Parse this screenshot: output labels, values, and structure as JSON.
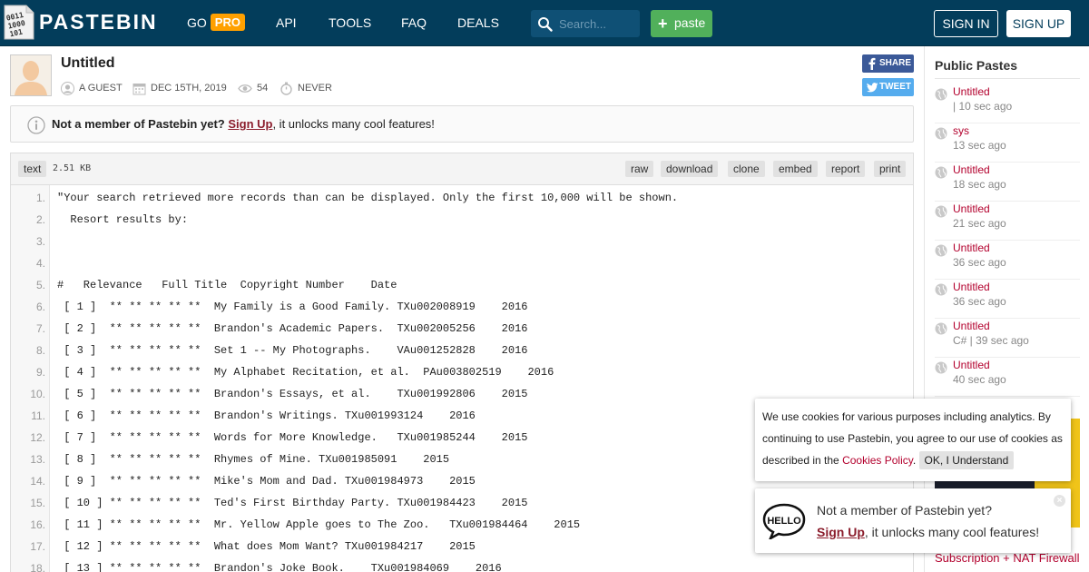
{
  "header": {
    "logo_text": "PASTEBIN",
    "nav": {
      "go": "GO",
      "pro": "PRO",
      "api": "API",
      "tools": "TOOLS",
      "faq": "FAQ",
      "deals": "DEALS"
    },
    "search_placeholder": "Search...",
    "paste_label": "paste",
    "sign_in": "SIGN IN",
    "sign_up": "SIGN UP"
  },
  "paste": {
    "title": "Untitled",
    "author": "A GUEST",
    "date": "DEC 15TH, 2019",
    "views": "54",
    "expires": "NEVER",
    "share_label": "SHARE",
    "tweet_label": "TWEET"
  },
  "notice": {
    "bold": "Not a member of Pastebin yet?",
    "link": "Sign Up",
    "rest": ", it unlocks many cool features!"
  },
  "code": {
    "format": "text",
    "size": "2.51 KB",
    "actions": [
      "raw",
      "download",
      "clone",
      "embed",
      "report",
      "print"
    ],
    "lines": [
      "\"Your search retrieved more records than can be displayed. Only the first 10,000 will be shown.",
      "  Resort results by:",
      "",
      "",
      "#   Relevance   Full Title  Copyright Number    Date",
      " [ 1 ]  ** ** ** ** **  My Family is a Good Family. TXu002008919    2016",
      " [ 2 ]  ** ** ** ** **  Brandon's Academic Papers.  TXu002005256    2016",
      " [ 3 ]  ** ** ** ** **  Set 1 -- My Photographs.    VAu001252828    2016",
      " [ 4 ]  ** ** ** ** **  My Alphabet Recitation, et al.  PAu003802519    2016",
      " [ 5 ]  ** ** ** ** **  Brandon's Essays, et al.    TXu001992806    2015",
      " [ 6 ]  ** ** ** ** **  Brandon's Writings. TXu001993124    2016",
      " [ 7 ]  ** ** ** ** **  Words for More Knowledge.   TXu001985244    2015",
      " [ 8 ]  ** ** ** ** **  Rhymes of Mine. TXu001985091    2015",
      " [ 9 ]  ** ** ** ** **  Mike's Mom and Dad. TXu001984973    2015",
      " [ 10 ] ** ** ** ** **  Ted's First Birthday Party. TXu001984423    2015",
      " [ 11 ] ** ** ** ** **  Mr. Yellow Apple goes to The Zoo.   TXu001984464    2015",
      " [ 12 ] ** ** ** ** **  What does Mom Want? TXu001984217    2015",
      " [ 13 ] ** ** ** ** **  Brandon's Joke Book.    TXu001984069    2016"
    ]
  },
  "sidebar": {
    "title": "Public Pastes",
    "items": [
      {
        "name": "Untitled",
        "time": "| 10 sec ago"
      },
      {
        "name": "sys",
        "time": "13 sec ago"
      },
      {
        "name": "Untitled",
        "time": "18 sec ago"
      },
      {
        "name": "Untitled",
        "time": "21 sec ago"
      },
      {
        "name": "Untitled",
        "time": "36 sec ago"
      },
      {
        "name": "Untitled",
        "time": "36 sec ago"
      },
      {
        "name": "Untitled",
        "time": "C# | 39 sec ago"
      },
      {
        "name": "Untitled",
        "time": "40 sec ago"
      }
    ],
    "promo_text": "Subscription + NAT Firewall"
  },
  "cookie": {
    "text": "We use cookies for various purposes including analytics. By continuing to use Pastebin, you agree to our use of cookies as described in the ",
    "link": "Cookies Policy",
    "after": ". ",
    "ok": "OK, I Understand"
  },
  "hello": {
    "line1": "Not a member of Pastebin yet?",
    "link": "Sign Up",
    "line2_rest": ", it unlocks many cool features!",
    "close": "×"
  },
  "colors": {
    "header_bg": "#033d5b",
    "pro_badge": "#ffa000",
    "paste_button": "#51b05b",
    "link_red": "#b3002d",
    "facebook": "#3b5998",
    "twitter": "#55acee"
  }
}
